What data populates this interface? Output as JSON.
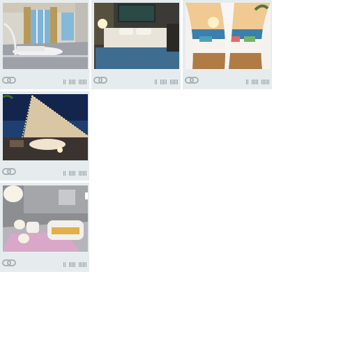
{
  "gallery": {
    "items": [
      {
        "theme": "modern-living-room",
        "icon": "chain-link-icon",
        "colors": {
          "sky": "#7fb3d6",
          "wall": "#d8d5cc",
          "floor": "#9ea1a8"
        }
      },
      {
        "theme": "dark-bedroom",
        "icon": "chain-link-icon",
        "colors": {
          "wall": "#3b3a36",
          "bed": "#e8e4da",
          "blanket": "#3e6d8f"
        }
      },
      {
        "theme": "beach-canopy-bed",
        "icon": "chain-link-icon",
        "colors": {
          "sky": "#f0c993",
          "sea": "#3a7fae",
          "curtain": "#f4f2ef"
        }
      },
      {
        "theme": "night-beach-tent",
        "icon": "chain-link-icon",
        "colors": {
          "sky": "#14254d",
          "tent": "#d9c6a4",
          "lights": "#ffe9a8"
        }
      },
      {
        "theme": "white-lounge",
        "icon": "chain-link-icon",
        "colors": {
          "wall": "#8d8e91",
          "sofa": "#f2f0ea",
          "cushion": "#e2b04a",
          "rug": "#d9a8c8"
        }
      }
    ]
  }
}
